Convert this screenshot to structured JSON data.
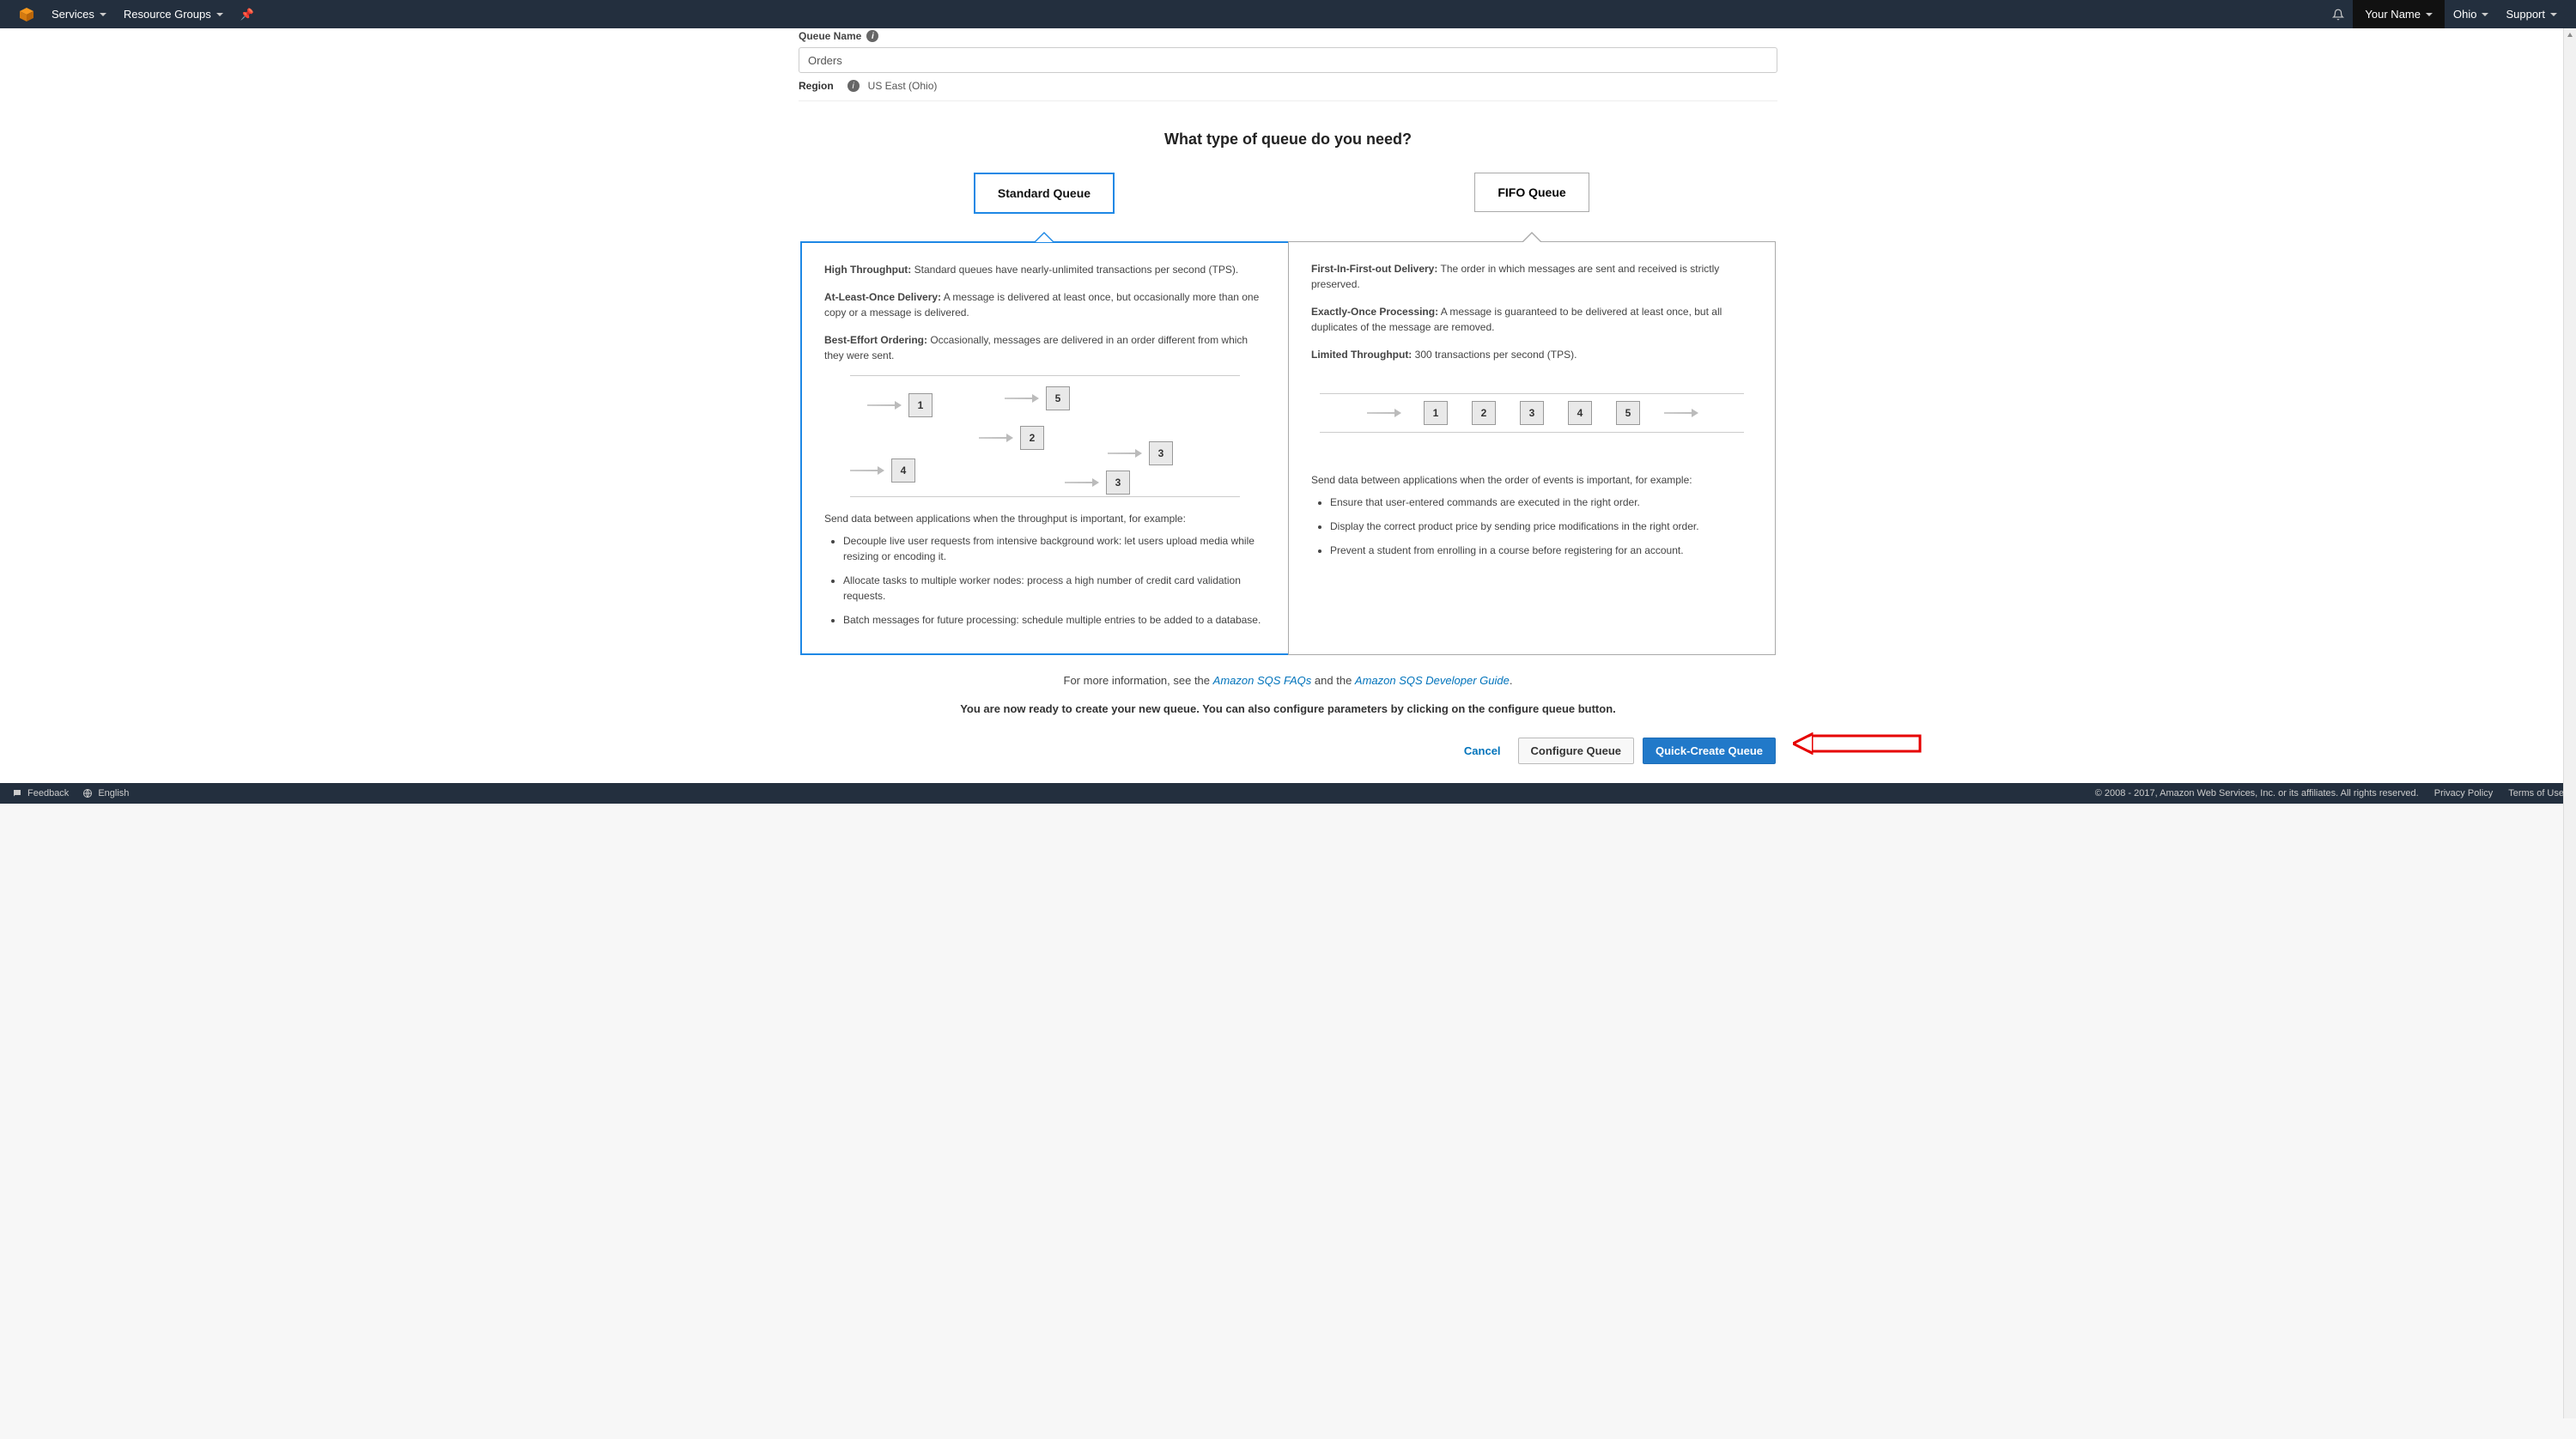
{
  "topnav": {
    "services_label": "Services",
    "resource_groups_label": "Resource Groups",
    "username_label": "Your Name",
    "region_label": "Ohio",
    "support_label": "Support"
  },
  "form": {
    "queue_name_label": "Queue Name",
    "queue_name_value": "Orders",
    "region_label": "Region",
    "region_value": "US East (Ohio)"
  },
  "heading": "What type of queue do you need?",
  "tabs": {
    "standard": "Standard Queue",
    "fifo": "FIFO Queue"
  },
  "standard": {
    "feat1_title": "High Throughput:",
    "feat1_body": "Standard queues have nearly-unlimited transactions per second (TPS).",
    "feat2_title": "At-Least-Once Delivery:",
    "feat2_body": "A message is delivered at least once, but occasionally more than one copy or a message is delivered.",
    "feat3_title": "Best-Effort Ordering:",
    "feat3_body": "Occasionally, messages are delivered in an order different from which they were sent.",
    "desc": "Send data between applications when the throughput is important, for example:",
    "bullet1": "Decouple live user requests from intensive background work: let users upload media while resizing or encoding it.",
    "bullet2": "Allocate tasks to multiple worker nodes: process a high number of credit card validation requests.",
    "bullet3": "Batch messages for future processing: schedule multiple entries to be added to a database.",
    "boxes": [
      "1",
      "5",
      "2",
      "3",
      "4",
      "3"
    ]
  },
  "fifo": {
    "feat1_title": "First-In-First-out Delivery:",
    "feat1_body": "The order in which messages are sent and received is strictly preserved.",
    "feat2_title": "Exactly-Once Processing:",
    "feat2_body": "A message is guaranteed to be delivered at least once, but all duplicates of the message are removed.",
    "feat3_title": "Limited Throughput:",
    "feat3_body": "300 transactions per second (TPS).",
    "desc": "Send data between applications when the order of events is important, for example:",
    "bullet1": "Ensure that user-entered commands are executed in the right order.",
    "bullet2": "Display the correct product price by sending price modifications in the right order.",
    "bullet3": "Prevent a student from enrolling in a course before registering for an account.",
    "boxes": [
      "1",
      "2",
      "3",
      "4",
      "5"
    ]
  },
  "moreinfo": {
    "prefix": "For more information, see the",
    "link1": "Amazon SQS FAQs",
    "mid": "and the",
    "link2": "Amazon SQS Developer Guide",
    "suffix": "."
  },
  "ready_line": "You are now ready to create your new queue. You can also configure parameters by clicking on the configure queue button.",
  "actions": {
    "cancel": "Cancel",
    "configure": "Configure Queue",
    "quick": "Quick-Create Queue"
  },
  "footer": {
    "feedback": "Feedback",
    "language": "English",
    "copyright": "© 2008 - 2017, Amazon Web Services, Inc. or its affiliates. All rights reserved.",
    "privacy": "Privacy Policy",
    "terms": "Terms of Use"
  }
}
